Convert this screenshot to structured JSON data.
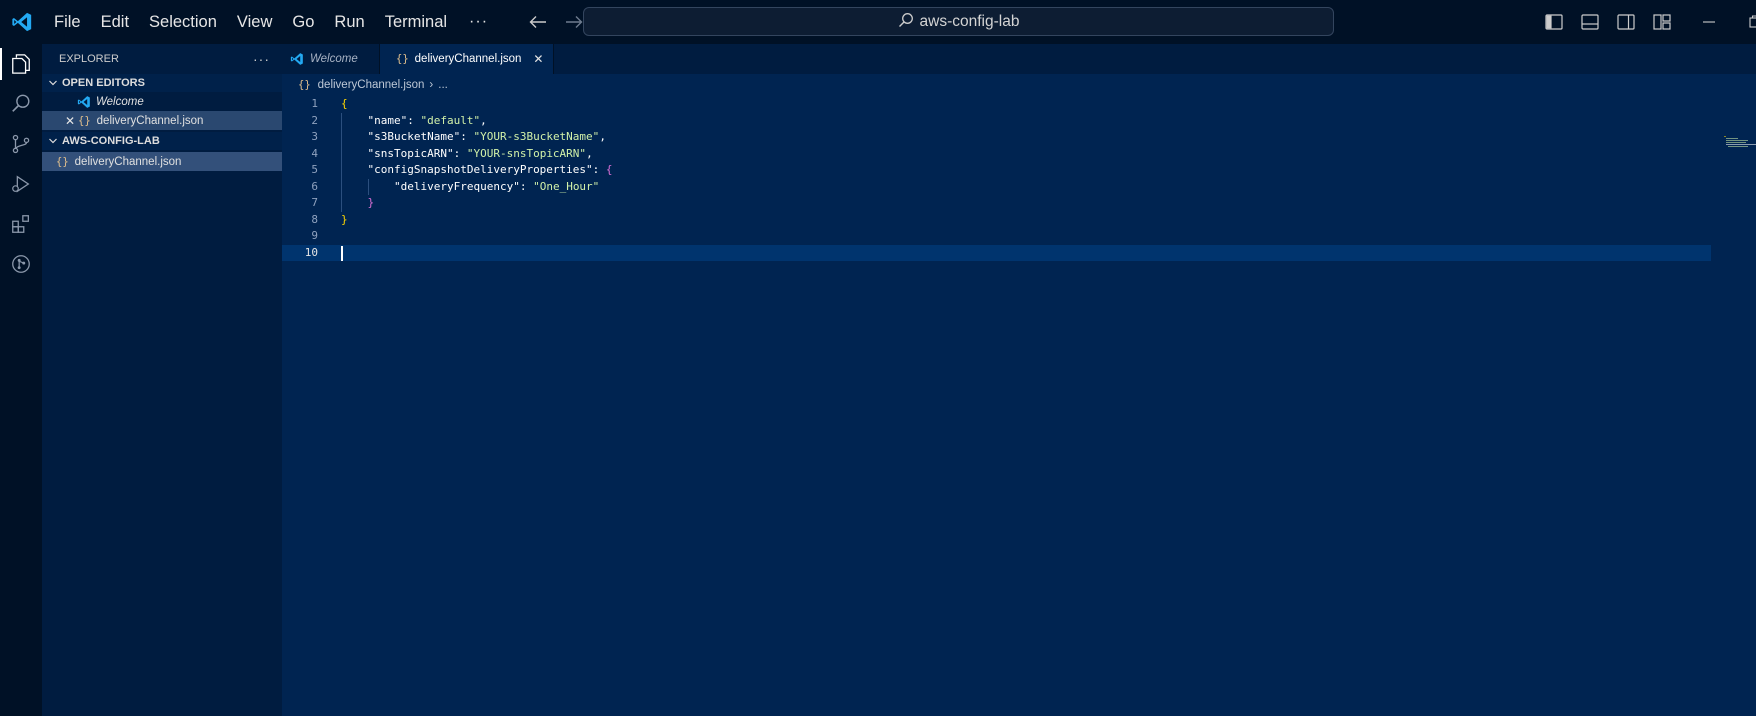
{
  "titlebar": {
    "menu": [
      "File",
      "Edit",
      "Selection",
      "View",
      "Go",
      "Run",
      "Terminal"
    ],
    "more_label": "···",
    "search_text": "aws-config-lab"
  },
  "sidebar": {
    "title": "EXPLORER",
    "more_label": "···",
    "open_editors": {
      "title": "OPEN EDITORS",
      "items": [
        {
          "label": "Welcome"
        },
        {
          "label": "deliveryChannel.json"
        }
      ]
    },
    "folder": {
      "title": "AWS-CONFIG-LAB",
      "items": [
        {
          "label": "deliveryChannel.json"
        }
      ]
    }
  },
  "tabs": [
    {
      "label": "Welcome",
      "active": false
    },
    {
      "label": "deliveryChannel.json",
      "active": true
    }
  ],
  "breadcrumbs": {
    "file": "deliveryChannel.json",
    "separator": "›",
    "rest": "..."
  },
  "json_glyph": "{}",
  "code": {
    "line_numbers": [
      "1",
      "2",
      "3",
      "4",
      "5",
      "6",
      "7",
      "8",
      "9",
      "10"
    ],
    "lines": {
      "l1_open": "{",
      "l2_key": "\"name\"",
      "l2_val": "\"default\"",
      "l3_key": "\"s3BucketName\"",
      "l3_val": "\"YOUR-s3BucketName\"",
      "l4_key": "\"snsTopicARN\"",
      "l4_val": "\"YOUR-snsTopicARN\"",
      "l5_key": "\"configSnapshotDeliveryProperties\"",
      "l5_open": "{",
      "l6_key": "\"deliveryFrequency\"",
      "l6_val": "\"One_Hour\"",
      "l7_close": "}",
      "l8_close": "}"
    },
    "colon": ": ",
    "comma": ","
  },
  "colors": {
    "background": "#002451",
    "sidebar": "#001c40",
    "titlebar": "#001126",
    "accent": "#0a84ff",
    "string": "#d1f1a9",
    "brace_level1": "#ffd700",
    "brace_level2": "#da70d6"
  }
}
